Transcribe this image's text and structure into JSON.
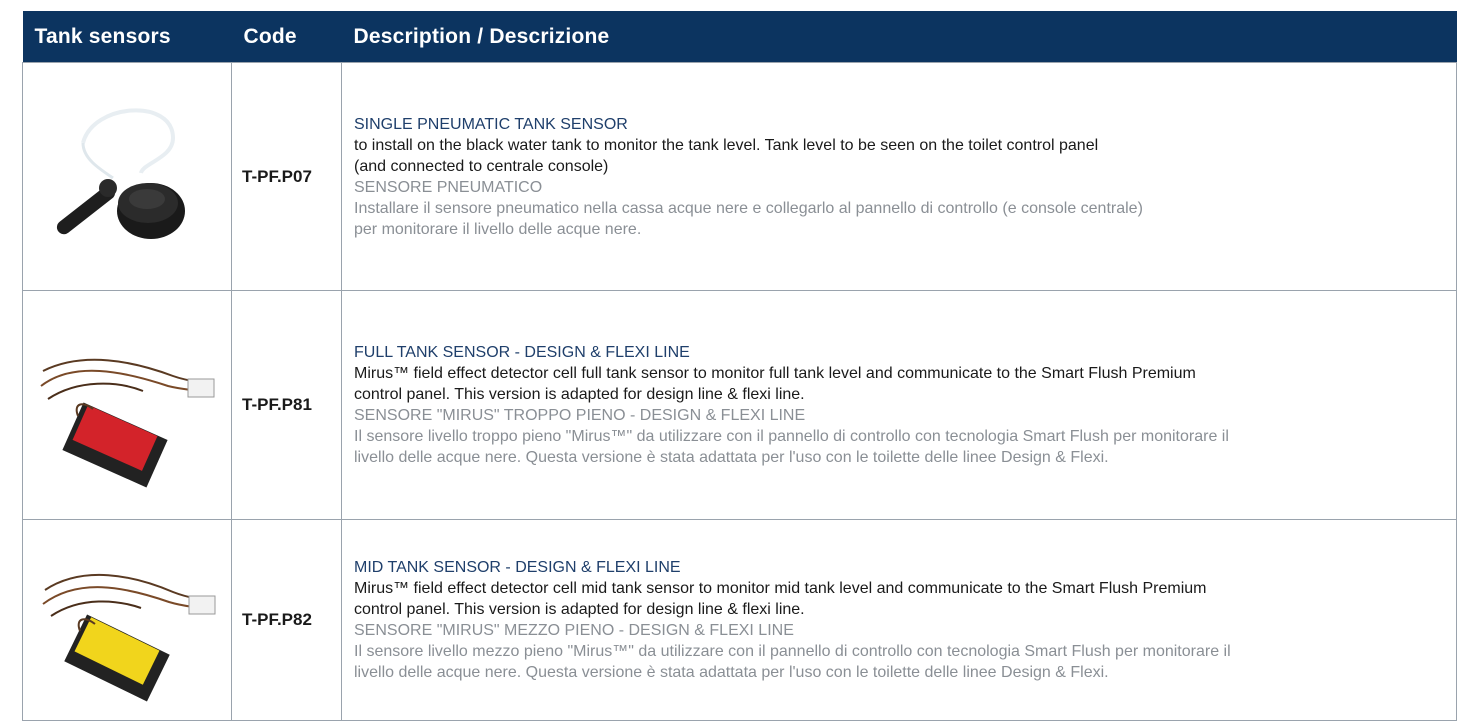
{
  "header": {
    "col1": "Tank sensors",
    "col2": "Code",
    "col3": "Description / Descrizione"
  },
  "rows": [
    {
      "code": "T-PF.P07",
      "image_icon": "pneumatic-sensor-icon",
      "title": "SINGLE PNEUMATIC TANK SENSOR",
      "en": [
        "to install on the black water tank to monitor the tank level. Tank level to be seen on the toilet control panel",
        "(and connected to centrale console)"
      ],
      "it_title": "SENSORE PNEUMATICO",
      "it": [
        "Installare il sensore pneumatico nella cassa acque nere e collegarlo al pannello di controllo (e console centrale)",
        "per monitorare il livello delle acque nere."
      ]
    },
    {
      "code": "T-PF.P81",
      "image_icon": "red-sensor-box-icon",
      "title": "FULL TANK SENSOR - DESIGN & FLEXI LINE",
      "en": [
        "Mirus™ field effect detector cell full tank sensor to monitor full tank level and communicate to the Smart Flush Premium",
        "control panel. This version is adapted for design line & flexi line."
      ],
      "it_title": "SENSORE \"MIRUS\" TROPPO PIENO - DESIGN & FLEXI LINE",
      "it": [
        "Il sensore livello troppo pieno \"Mirus™\" da utilizzare con il pannello di controllo con tecnologia Smart Flush per monitorare il",
        "livello delle acque nere. Questa versione è stata adattata per l'uso con le toilette delle linee Design & Flexi."
      ]
    },
    {
      "code": "T-PF.P82",
      "image_icon": "yellow-sensor-box-icon",
      "title": "MID TANK SENSOR - DESIGN & FLEXI LINE",
      "en": [
        "Mirus™ field effect detector cell mid tank sensor to monitor mid tank level and communicate to the Smart Flush Premium",
        "control panel. This version is adapted for design line & flexi line."
      ],
      "it_title": "SENSORE \"MIRUS\" MEZZO PIENO - DESIGN & FLEXI LINE",
      "it": [
        "Il sensore livello mezzo pieno \"Mirus™\" da utilizzare con il pannello di controllo con tecnologia Smart Flush per monitorare il",
        "livello delle acque nere. Questa versione è stata adattata per l'uso con le toilette delle linee Design & Flexi."
      ]
    }
  ],
  "colors": {
    "header_bg": "#0c3460",
    "title_text": "#1f3f6b",
    "italian_text": "#8a8f95",
    "grid_line": "#9aa3ad"
  }
}
